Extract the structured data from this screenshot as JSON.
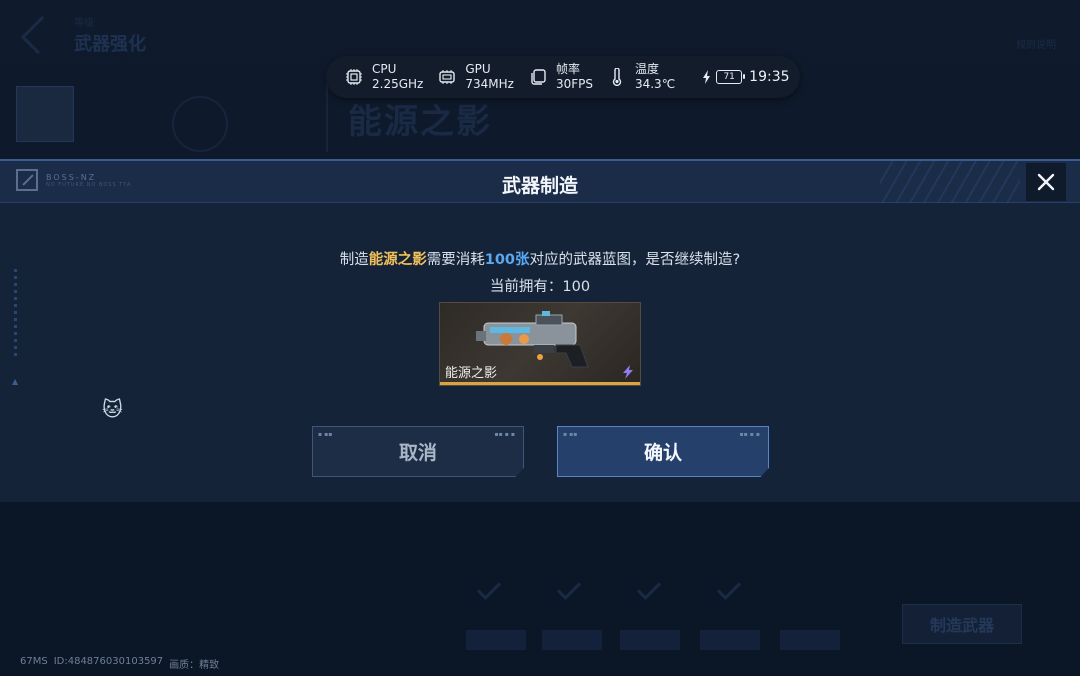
{
  "background": {
    "small_title": "等级",
    "title": "武器强化",
    "heading": "能源之影",
    "top_right": "规则说明",
    "right_button": "制造武器"
  },
  "status_bar": {
    "cpu_label": "CPU",
    "cpu_value": "2.25GHz",
    "gpu_label": "GPU",
    "gpu_value": "734MHz",
    "fps_label": "帧率",
    "fps_value": "30FPS",
    "temp_label": "温度",
    "temp_value": "34.3℃",
    "battery": "71",
    "clock": "19:35"
  },
  "dialog": {
    "title": "武器制造",
    "logo_line1": "BOSS-NZ",
    "logo_line2": "NO FUTURE NO BOSS TTA",
    "message_prefix": "制造",
    "weapon_name": "能源之影",
    "message_mid": "需要消耗",
    "cost": "100张",
    "message_suffix": "对应的武器蓝图，是否继续制造?",
    "owned_label": "当前拥有：",
    "owned_value": "100",
    "card_name": "能源之影",
    "cancel_label": "取消",
    "confirm_label": "确认"
  },
  "footer": {
    "ping": "67MS",
    "id": "ID:484876030103597",
    "quality": "画质：精致"
  },
  "colors": {
    "highlight_gold": "#f0c05a",
    "highlight_blue": "#5aa8f0",
    "card_rarity_bar": "#d9a441",
    "confirm_border": "#5b84c4"
  }
}
